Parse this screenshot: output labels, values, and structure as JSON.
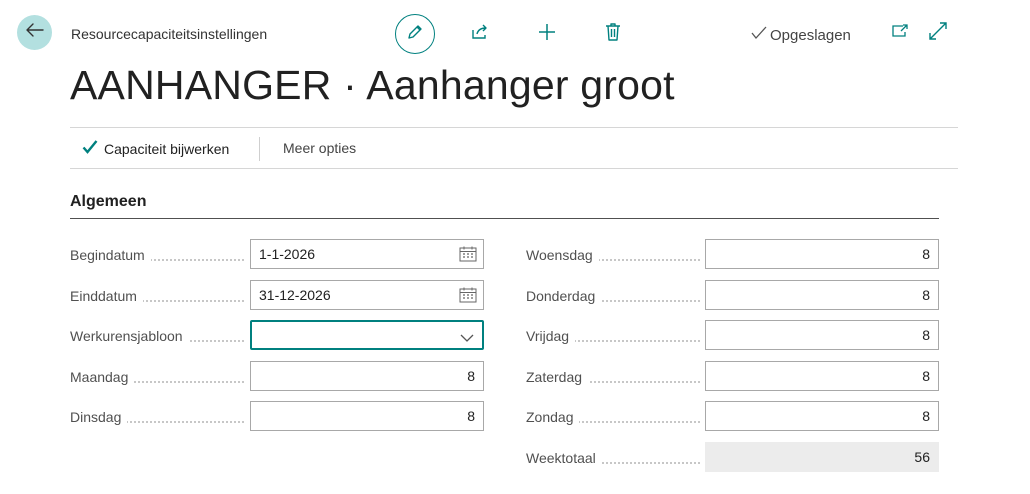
{
  "header": {
    "breadcrumb": "Resourcecapaciteitsinstellingen",
    "status": "Opgeslagen",
    "title": "AANHANGER · Aanhanger groot"
  },
  "icons": {
    "back": "arrow-left-icon",
    "edit": "pencil-icon",
    "share": "share-icon",
    "add": "plus-icon",
    "delete": "trash-icon",
    "saved": "checkmark-icon",
    "open_new_window": "open-in-new-window-icon",
    "expand": "expand-icon"
  },
  "actions": {
    "update_capacity": "Capaciteit bijwerken",
    "more_options": "Meer opties"
  },
  "section": {
    "title": "Algemeen"
  },
  "fields_left": {
    "start_date": {
      "label": "Begindatum",
      "value": "1-1-2026"
    },
    "end_date": {
      "label": "Einddatum",
      "value": "31-12-2026"
    },
    "work_hour_template": {
      "label": "Werkurensjabloon",
      "value": ""
    },
    "monday": {
      "label": "Maandag",
      "value": "8"
    },
    "tuesday": {
      "label": "Dinsdag",
      "value": "8"
    }
  },
  "fields_right": {
    "wednesday": {
      "label": "Woensdag",
      "value": "8"
    },
    "thursday": {
      "label": "Donderdag",
      "value": "8"
    },
    "friday": {
      "label": "Vrijdag",
      "value": "8"
    },
    "saturday": {
      "label": "Zaterdag",
      "value": "8"
    },
    "sunday": {
      "label": "Zondag",
      "value": "8"
    },
    "week_total": {
      "label": "Weektotaal",
      "value": "56"
    }
  },
  "colors": {
    "accent": "#00807f",
    "back_button_bg": "#b3e0e0",
    "readonly_bg": "#ececec"
  }
}
